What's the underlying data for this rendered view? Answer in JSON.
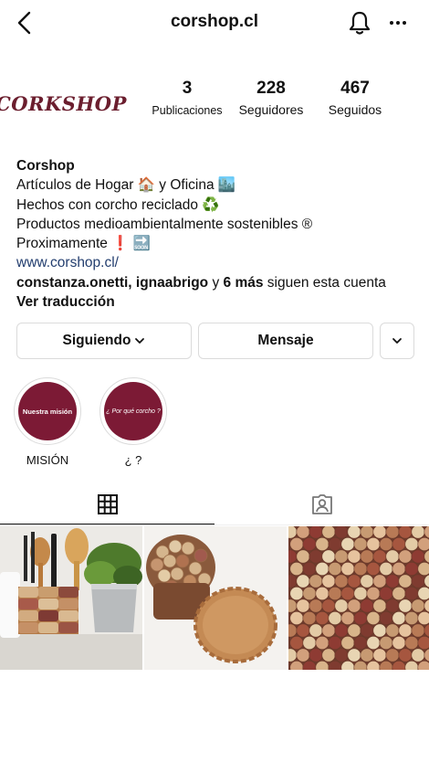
{
  "header": {
    "title": "corshop.cl",
    "back_icon": "chevron-left-icon",
    "bell_icon": "bell-icon",
    "more_icon": "more-horizontal-icon"
  },
  "profile": {
    "avatar_text": "CORKSHOP",
    "stats": [
      {
        "value": "3",
        "label": "Publicaciones"
      },
      {
        "value": "228",
        "label": "Seguidores"
      },
      {
        "value": "467",
        "label": "Seguidos"
      }
    ]
  },
  "bio": {
    "name": "Corshop",
    "line1": "Artículos de Hogar 🏠 y Oficina 🏙️",
    "line2": "Hechos con corcho reciclado ♻️",
    "line3": "Productos medioambientalmente sostenibles ®",
    "line4": "Proximamente ❗ 🔜",
    "link": "www.corshop.cl/",
    "followed_by_names": "constanza.onetti, ignaabrigo",
    "followed_by_y": " y ",
    "followed_by_count": "6 más",
    "followed_by_suffix": " siguen esta cuenta",
    "translate": "Ver traducción"
  },
  "actions": {
    "following": "Siguiendo",
    "message": "Mensaje"
  },
  "highlights": [
    {
      "inner": "Nuestra misión",
      "label": "MISIÓN"
    },
    {
      "inner": "¿ Por qué corcho ?",
      "label": "¿ ?"
    }
  ],
  "tabs": {
    "grid_icon": "grid-icon",
    "tagged_icon": "tagged-person-icon"
  },
  "colors": {
    "brand_maroon": "#7c1a35",
    "link_blue": "#223d6e",
    "border": "#dbdbdb"
  }
}
